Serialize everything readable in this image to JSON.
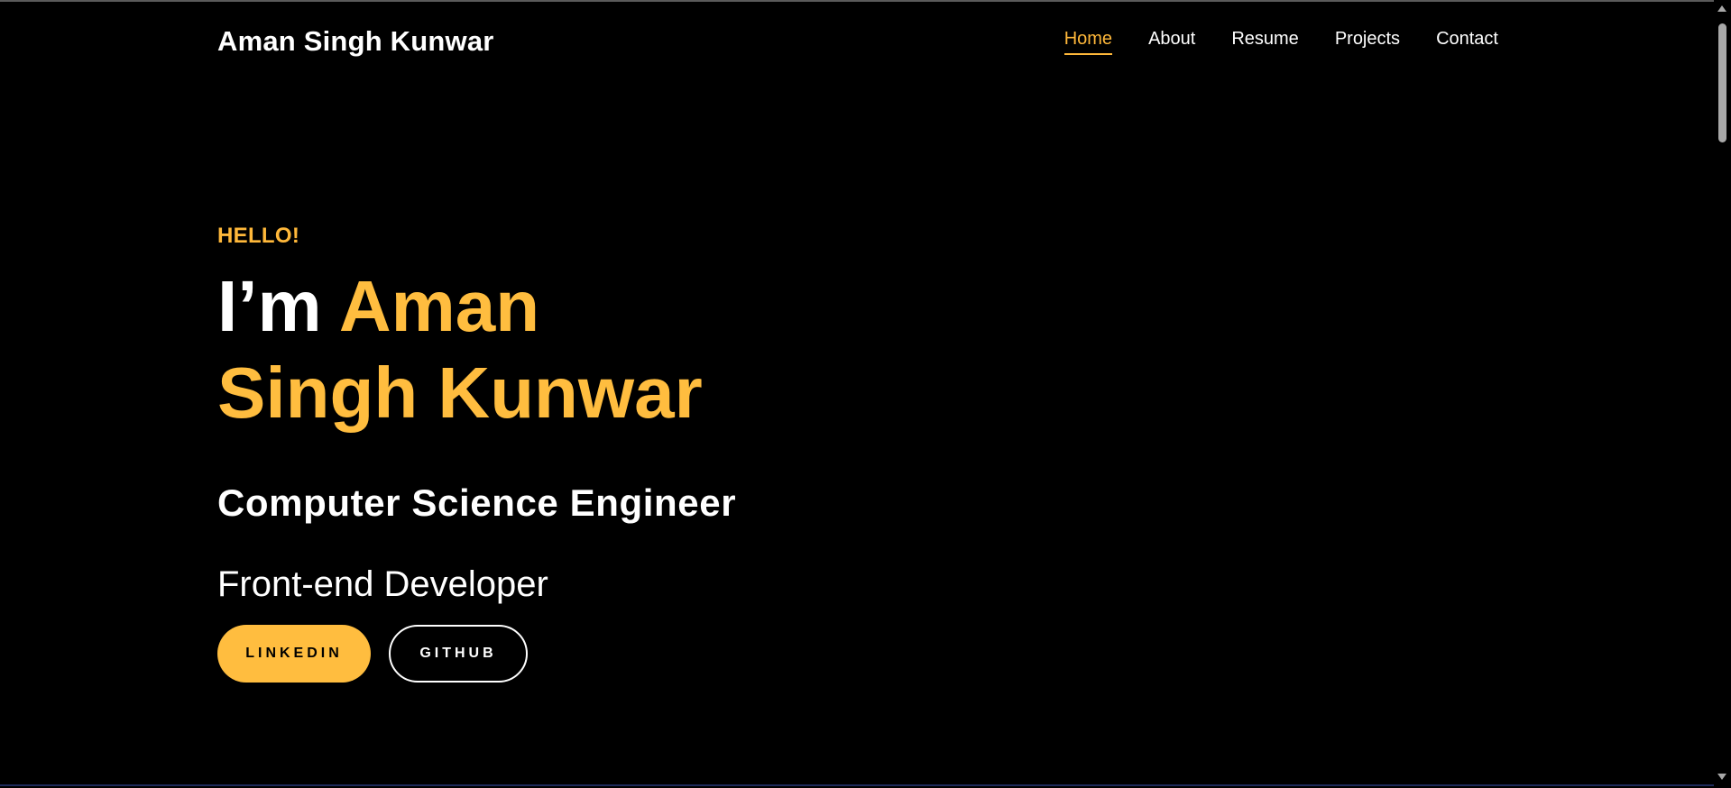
{
  "header": {
    "brand": "Aman Singh Kunwar",
    "nav": [
      {
        "label": "Home",
        "active": true
      },
      {
        "label": "About",
        "active": false
      },
      {
        "label": "Resume",
        "active": false
      },
      {
        "label": "Projects",
        "active": false
      },
      {
        "label": "Contact",
        "active": false
      }
    ]
  },
  "hero": {
    "greeting": "HELLO!",
    "title_prefix": "I’m ",
    "title_first": "Aman",
    "title_rest": "Singh Kunwar",
    "role": "Computer Science Engineer",
    "subrole": "Front-end Developer",
    "buttons": {
      "linkedin": "LINKEDIN",
      "github": "GITHUB"
    }
  },
  "colors": {
    "accent": "#ffbd3f",
    "background": "#000000",
    "text": "#ffffff"
  }
}
